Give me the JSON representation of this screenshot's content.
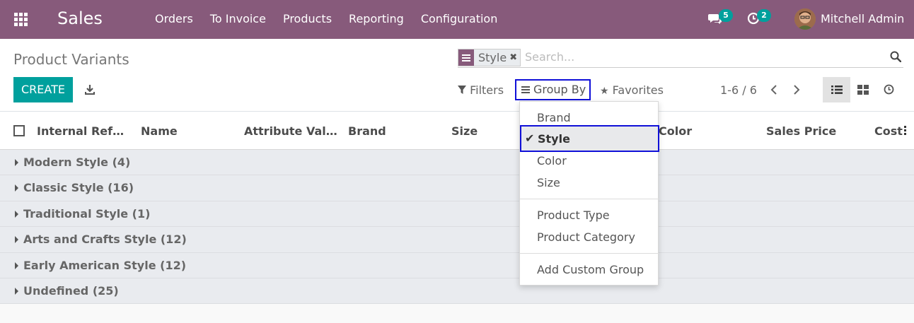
{
  "navbar": {
    "brand": "Sales",
    "menu": [
      "Orders",
      "To Invoice",
      "Products",
      "Reporting",
      "Configuration"
    ],
    "messages_count": "5",
    "activities_count": "2",
    "user_name": "Mitchell Admin"
  },
  "control": {
    "title": "Product Variants",
    "facet_value": "Style",
    "search_placeholder": "Search...",
    "create_label": "CREATE",
    "filters_label": "Filters",
    "groupby_label": "Group By",
    "favorites_label": "Favorites",
    "pager": "1-6 / 6"
  },
  "columns": [
    "Internal Ref…",
    "Name",
    "Attribute Val…",
    "Brand",
    "Size",
    "Color",
    "Sales Price",
    "Cost"
  ],
  "groups": [
    "Modern Style (4)",
    "Classic Style (16)",
    "Traditional Style (1)",
    "Arts and Crafts Style (12)",
    "Early American Style (12)",
    "Undefined (25)"
  ],
  "groupby_menu": {
    "brand": "Brand",
    "style": "Style",
    "color": "Color",
    "size": "Size",
    "product_type": "Product Type",
    "product_category": "Product Category",
    "add_custom": "Add Custom Group"
  },
  "colors": {
    "navbar": "#875a7b",
    "primary": "#00a09d",
    "highlight_border": "#1010d8"
  }
}
